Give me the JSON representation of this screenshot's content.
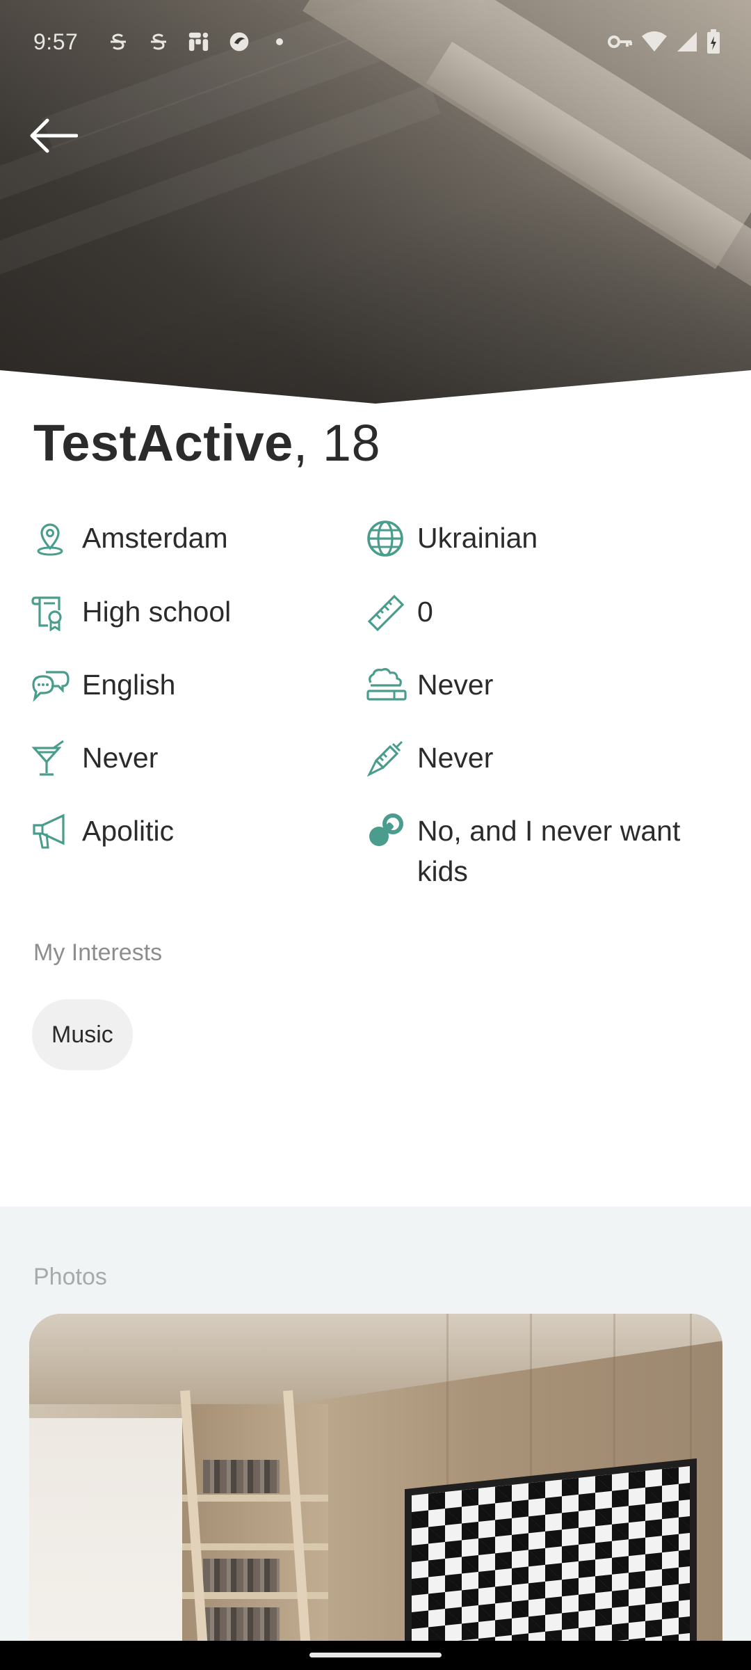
{
  "status_bar": {
    "time": "9:57",
    "notification_icons": [
      "strikethrough-s-icon",
      "strikethrough-s-icon",
      "fi-app-icon",
      "circle-app-icon",
      "dot-icon"
    ],
    "system_icons": [
      "vpn-key-icon",
      "wifi-icon",
      "signal-icon",
      "battery-charging-icon"
    ]
  },
  "profile": {
    "name": "TestActive",
    "age_text": ", 18",
    "details_left": [
      {
        "icon": "location-pin-icon",
        "value": "Amsterdam"
      },
      {
        "icon": "diploma-icon",
        "value": "High school"
      },
      {
        "icon": "speech-bubbles-icon",
        "value": "English"
      },
      {
        "icon": "cocktail-icon",
        "value": "Never"
      },
      {
        "icon": "megaphone-icon",
        "value": "Apolitic"
      }
    ],
    "details_right": [
      {
        "icon": "globe-icon",
        "value": "Ukrainian"
      },
      {
        "icon": "ruler-icon",
        "value": "0"
      },
      {
        "icon": "smoking-icon",
        "value": "Never"
      },
      {
        "icon": "syringe-icon",
        "value": "Never"
      },
      {
        "icon": "pacifier-icon",
        "value": "No, and I never want kids"
      }
    ]
  },
  "interests": {
    "label": "My Interests",
    "items": [
      "Music"
    ]
  },
  "photos": {
    "label": "Photos"
  },
  "colors": {
    "accent": "#4a9d8c",
    "text": "#2b2b2b",
    "muted_label": "#8d8d8d",
    "chip_bg": "#f0f0f0",
    "photos_bg": "#f1f4f4"
  }
}
